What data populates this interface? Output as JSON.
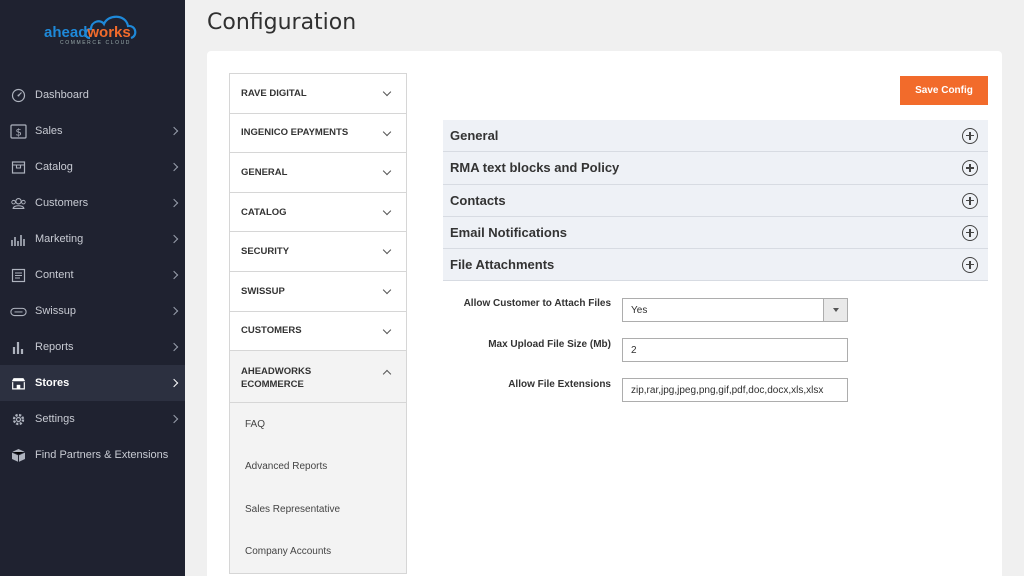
{
  "logo": {
    "part1": "ahead",
    "part2": "works",
    "sub": "COMMERCE CLOUD"
  },
  "page_title": "Configuration",
  "sidebar": {
    "items": [
      {
        "label": "Dashboard",
        "icon": "dashboard-icon",
        "chevron": false,
        "active": false
      },
      {
        "label": "Sales",
        "icon": "dollar-icon",
        "chevron": true,
        "active": false
      },
      {
        "label": "Catalog",
        "icon": "catalog-box-icon",
        "chevron": true,
        "active": false
      },
      {
        "label": "Customers",
        "icon": "customers-icon",
        "chevron": true,
        "active": false
      },
      {
        "label": "Marketing",
        "icon": "marketing-bars-icon",
        "chevron": true,
        "active": false
      },
      {
        "label": "Content",
        "icon": "content-icon",
        "chevron": true,
        "active": false
      },
      {
        "label": "Swissup",
        "icon": "swissup-icon",
        "chevron": true,
        "active": false
      },
      {
        "label": "Reports",
        "icon": "reports-icon",
        "chevron": true,
        "active": false
      },
      {
        "label": "Stores",
        "icon": "stores-icon",
        "chevron": true,
        "active": true
      },
      {
        "label": "Settings",
        "icon": "gear-icon",
        "chevron": true,
        "active": false
      },
      {
        "label": "Find Partners & Extensions",
        "icon": "extensions-box-icon",
        "chevron": false,
        "active": false
      }
    ]
  },
  "config_tabs": {
    "items": [
      {
        "label": "RAVE DIGITAL"
      },
      {
        "label": "INGENICO EPAYMENTS"
      },
      {
        "label": "GENERAL"
      },
      {
        "label": "CATALOG"
      },
      {
        "label": "SECURITY"
      },
      {
        "label": "SWISSUP"
      },
      {
        "label": "CUSTOMERS"
      }
    ],
    "open_tab": {
      "label_line1": "AHEADWORKS",
      "label_line2": "ECOMMERCE"
    },
    "subitems": [
      {
        "label": "FAQ"
      },
      {
        "label": "Advanced Reports"
      },
      {
        "label": "Sales Representative"
      },
      {
        "label": "Company Accounts"
      }
    ]
  },
  "toolbar": {
    "save_label": "Save Config"
  },
  "sections": [
    {
      "label": "General"
    },
    {
      "label": "RMA text blocks and Policy"
    },
    {
      "label": "Contacts"
    },
    {
      "label": "Email Notifications"
    },
    {
      "label": "File Attachments"
    }
  ],
  "form": {
    "attach_label": "Allow Customer to Attach Files",
    "attach_value": "Yes",
    "max_size_label": "Max Upload File Size (Mb)",
    "max_size_value": "2",
    "extensions_label": "Allow File Extensions",
    "extensions_value": "zip,rar,jpg,jpeg,png,gif,pdf,doc,docx,xls,xlsx"
  },
  "colors": {
    "sidebar_bg": "#1f2230",
    "accent": "#f26b2b",
    "brand_blue": "#1e89d9",
    "section_bg": "#eef1f6"
  }
}
